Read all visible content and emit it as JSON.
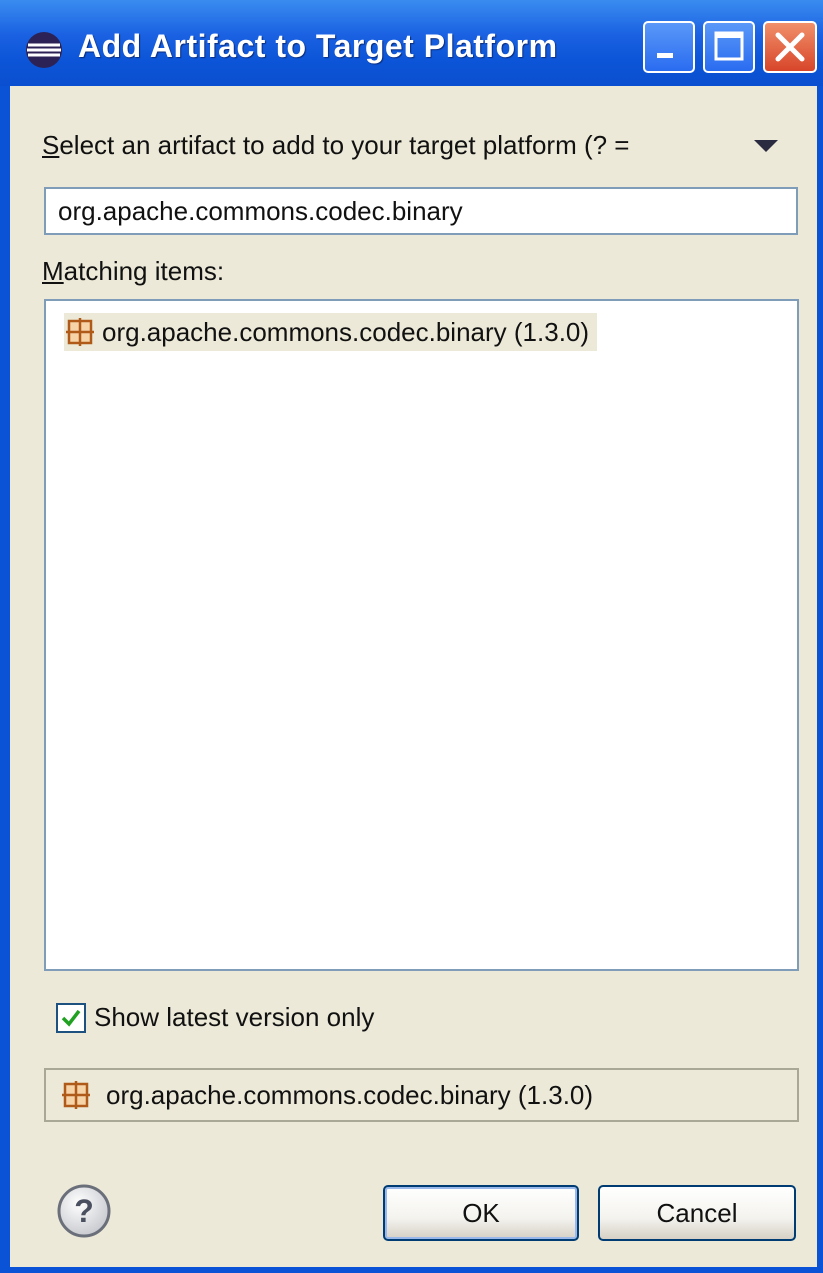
{
  "window": {
    "title": "Add Artifact to Target Platform"
  },
  "form": {
    "prompt_label_accel": "S",
    "prompt_label_rest": "elect an artifact to add to your target platform (? =",
    "search_value": "org.apache.commons.codec.binary",
    "matching_label_accel": "M",
    "matching_label_rest": "atching items:"
  },
  "results": {
    "items": [
      {
        "label": "org.apache.commons.codec.binary (1.3.0)",
        "icon": "plugin-icon"
      }
    ]
  },
  "options": {
    "show_latest_label": "Show latest version only",
    "show_latest_checked": true
  },
  "selection": {
    "label": "org.apache.commons.codec.binary (1.3.0)",
    "icon": "plugin-icon"
  },
  "buttons": {
    "ok": "OK",
    "cancel": "Cancel"
  },
  "colors": {
    "titlebar": "#0a52d6",
    "dialog_bg": "#ece9d8",
    "border_blue": "#7f9db9",
    "close_red": "#d8452a",
    "plugin_icon": "#b05a1a"
  }
}
